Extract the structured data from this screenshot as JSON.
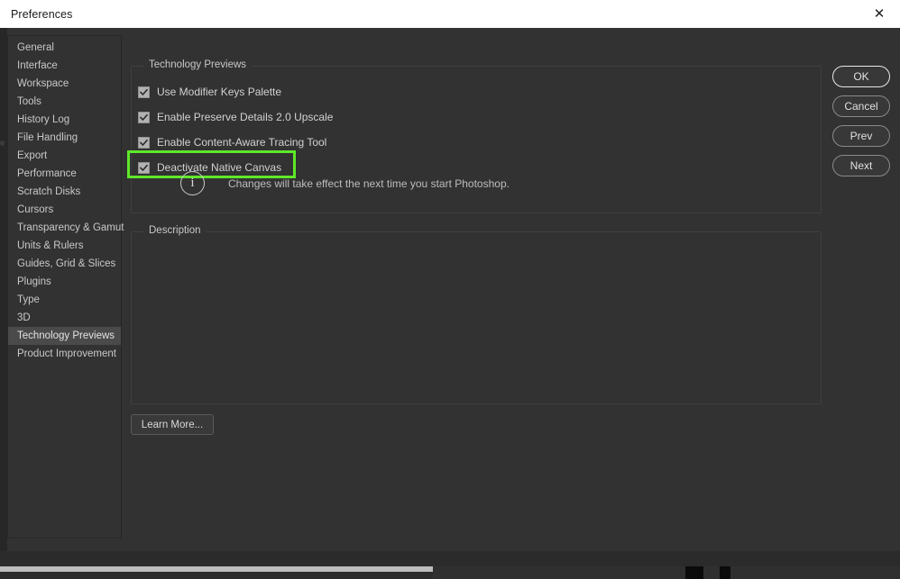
{
  "window": {
    "title": "Preferences",
    "close_icon": "close-icon",
    "close_glyph": "✕"
  },
  "sidebar": {
    "items": [
      {
        "label": "General",
        "selected": false
      },
      {
        "label": "Interface",
        "selected": false
      },
      {
        "label": "Workspace",
        "selected": false
      },
      {
        "label": "Tools",
        "selected": false
      },
      {
        "label": "History Log",
        "selected": false
      },
      {
        "label": "File Handling",
        "selected": false
      },
      {
        "label": "Export",
        "selected": false
      },
      {
        "label": "Performance",
        "selected": false
      },
      {
        "label": "Scratch Disks",
        "selected": false
      },
      {
        "label": "Cursors",
        "selected": false
      },
      {
        "label": "Transparency & Gamut",
        "selected": false
      },
      {
        "label": "Units & Rulers",
        "selected": false
      },
      {
        "label": "Guides, Grid & Slices",
        "selected": false
      },
      {
        "label": "Plugins",
        "selected": false
      },
      {
        "label": "Type",
        "selected": false
      },
      {
        "label": "3D",
        "selected": false
      },
      {
        "label": "Technology Previews",
        "selected": true
      },
      {
        "label": "Product Improvement",
        "selected": false
      }
    ]
  },
  "tech_previews": {
    "legend": "Technology Previews",
    "options": [
      {
        "label": "Use Modifier Keys Palette",
        "checked": true,
        "highlighted": false
      },
      {
        "label": "Enable Preserve Details 2.0 Upscale",
        "checked": true,
        "highlighted": false
      },
      {
        "label": "Enable Content-Aware Tracing Tool",
        "checked": true,
        "highlighted": false
      },
      {
        "label": "Deactivate Native Canvas",
        "checked": true,
        "highlighted": true
      }
    ],
    "note": {
      "icon": "info-icon",
      "glyph": "i",
      "text": "Changes will take effect the next time you start Photoshop."
    }
  },
  "description": {
    "legend": "Description",
    "body": ""
  },
  "learn_more": {
    "label": "Learn More..."
  },
  "buttons": [
    {
      "label": "OK",
      "primary": true
    },
    {
      "label": "Cancel",
      "primary": false
    },
    {
      "label": "Prev",
      "primary": false
    },
    {
      "label": "Next",
      "primary": false
    }
  ],
  "colors": {
    "highlight_green": "#5fe82a",
    "dialog_bg": "#323232",
    "titlebar_bg": "#ffffff",
    "selected_item_bg": "#4a4a4a",
    "text": "#d2d2d2"
  }
}
